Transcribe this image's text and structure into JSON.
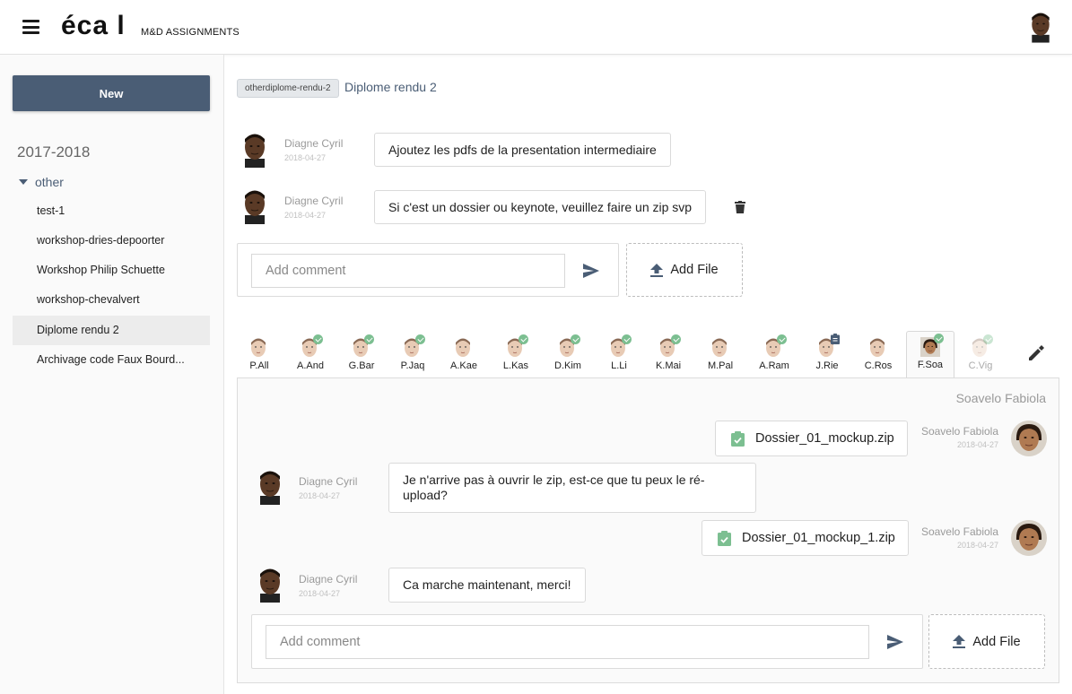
{
  "header": {
    "logo": "éca l",
    "subtitle": "M&D ASSIGNMENTS"
  },
  "sidebar": {
    "new_label": "New",
    "year": "2017-2018",
    "group": "other",
    "items": [
      {
        "label": "test-1"
      },
      {
        "label": "workshop-dries-depoorter"
      },
      {
        "label": "Workshop Philip Schuette"
      },
      {
        "label": "workshop-chevalvert"
      },
      {
        "label": "Diplome rendu 2"
      },
      {
        "label": "Archivage code Faux Bourd..."
      }
    ]
  },
  "assignment": {
    "tag": "otherdiplome-rendu-2",
    "title": "Diplome rendu 2"
  },
  "comments": [
    {
      "name": "Diagne Cyril",
      "date": "2018-04-27",
      "text": "Ajoutez les pdfs de la presentation intermediaire"
    },
    {
      "name": "Diagne Cyril",
      "date": "2018-04-27",
      "text": "Si c'est un dossier ou keynote, veuillez faire un zip svp"
    }
  ],
  "composer": {
    "placeholder": "Add comment",
    "add_file": "Add File"
  },
  "students": [
    {
      "label": "P.All",
      "status": "none"
    },
    {
      "label": "A.And",
      "status": "done"
    },
    {
      "label": "G.Bar",
      "status": "done"
    },
    {
      "label": "P.Jaq",
      "status": "done"
    },
    {
      "label": "A.Kae",
      "status": "none"
    },
    {
      "label": "L.Kas",
      "status": "done"
    },
    {
      "label": "D.Kim",
      "status": "done"
    },
    {
      "label": "L.Li",
      "status": "done"
    },
    {
      "label": "K.Mai",
      "status": "done"
    },
    {
      "label": "M.Pal",
      "status": "none"
    },
    {
      "label": "A.Ram",
      "status": "done"
    },
    {
      "label": "J.Rie",
      "status": "clipboard"
    },
    {
      "label": "C.Ros",
      "status": "none"
    },
    {
      "label": "F.Soa",
      "status": "done"
    },
    {
      "label": "C.Vig",
      "status": "done"
    }
  ],
  "thread": {
    "student_name": "Soavelo Fabiola",
    "messages": [
      {
        "type": "file",
        "side": "right",
        "name": "Soavelo Fabiola",
        "date": "2018-04-27",
        "text": "Dossier_01_mockup.zip"
      },
      {
        "type": "text",
        "side": "left",
        "name": "Diagne Cyril",
        "date": "2018-04-27",
        "text": "Je n'arrive pas à ouvrir le zip, est-ce que tu peux le ré-upload?"
      },
      {
        "type": "file",
        "side": "right",
        "name": "Soavelo Fabiola",
        "date": "2018-04-27",
        "text": "Dossier_01_mockup_1.zip"
      },
      {
        "type": "text",
        "side": "left",
        "name": "Diagne Cyril",
        "date": "2018-04-27",
        "text": "Ca marche maintenant, merci!"
      }
    ]
  },
  "colors": {
    "primary": "#4a5d75",
    "check": "#7cbf91",
    "panel_bg": "#fafafa"
  }
}
